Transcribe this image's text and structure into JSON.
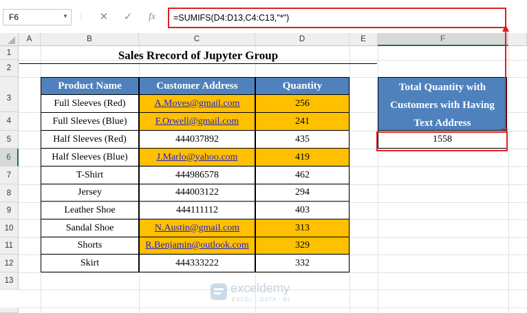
{
  "formula_bar": {
    "name_box": "F6",
    "name_box_arrow": "▼",
    "dots": "⋮",
    "cancel_glyph": "✕",
    "enter_glyph": "✓",
    "function_glyph": "fx",
    "formula": "=SUMIFS(D4:D13,C4:C13,\"*\")"
  },
  "columns": [
    "A",
    "B",
    "C",
    "D",
    "E",
    "F"
  ],
  "rows": [
    "1",
    "2",
    "3",
    "4",
    "5",
    "6",
    "7",
    "8",
    "9",
    "10",
    "11",
    "12",
    "13"
  ],
  "title": "Sales Rrecord of Jupyter Group",
  "table": {
    "headers": [
      "Product Name",
      "Customer Address",
      "Quantity"
    ],
    "rows": [
      {
        "product": "Full Sleeves (Red)",
        "address": "A.Moves@gmail.com",
        "quantity": "256",
        "is_email": true
      },
      {
        "product": "Full Sleeves (Blue)",
        "address": "F.Orwell@gmail.com",
        "quantity": "241",
        "is_email": true
      },
      {
        "product": "Half Sleeves (Red)",
        "address": "444037892",
        "quantity": "435",
        "is_email": false
      },
      {
        "product": "Half Sleeves (Blue)",
        "address": "J.Marlo@yahoo.com",
        "quantity": "419",
        "is_email": true
      },
      {
        "product": "T-Shirt",
        "address": "444986578",
        "quantity": "462",
        "is_email": false
      },
      {
        "product": "Jersey",
        "address": "444003122",
        "quantity": "294",
        "is_email": false
      },
      {
        "product": "Leather Shoe",
        "address": "444111112",
        "quantity": "403",
        "is_email": false
      },
      {
        "product": "Sandal Shoe",
        "address": "N.Austin@gmail.com",
        "quantity": "313",
        "is_email": true
      },
      {
        "product": "Shorts",
        "address": "R.Benjamin@outlook.com",
        "quantity": "329",
        "is_email": true
      },
      {
        "product": "Skirt",
        "address": "444333222",
        "quantity": "332",
        "is_email": false
      }
    ]
  },
  "summary": {
    "header_lines": [
      "Total Quantity with",
      "Customers with Having",
      "Text Address"
    ],
    "value": "1558"
  },
  "watermark": {
    "name": "exceldemy",
    "tagline": "EXCEL · DATA · BI"
  },
  "colors": {
    "header_blue": "#4f81bd",
    "highlight_orange": "#ffc000",
    "annotation_red": "#e31b23",
    "excel_green": "#217346"
  }
}
